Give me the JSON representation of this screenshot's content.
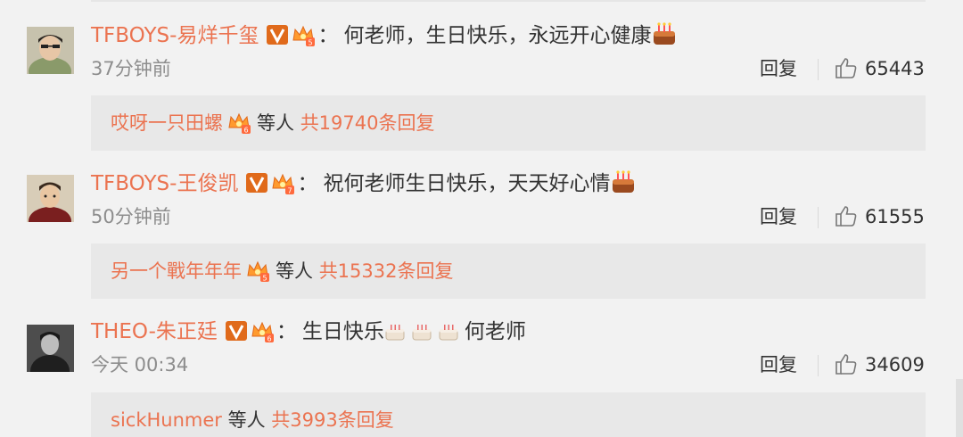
{
  "comments": [
    {
      "username": "TFBOYS-易烊千玺",
      "text": "何老师，生日快乐，永远开心健康",
      "time": "37分钟前",
      "reply_label": "回复",
      "likes": "65443",
      "reply_preview": {
        "user": "哎呀一只田螺",
        "middle": "等人",
        "count": "共19740条回复"
      }
    },
    {
      "username": "TFBOYS-王俊凯",
      "text": "祝何老师生日快乐，天天好心情",
      "time": "50分钟前",
      "reply_label": "回复",
      "likes": "61555",
      "reply_preview": {
        "user": "另一个戰年年年",
        "middle": "等人",
        "count": "共15332条回复"
      }
    },
    {
      "username": "THEO-朱正廷",
      "text": "生日快乐",
      "text_after": "何老师",
      "time": "今天 00:34",
      "reply_label": "回复",
      "likes": "34609",
      "reply_preview": {
        "user": "sickHunmer",
        "middle": "等人",
        "count": "共3993条回复"
      }
    }
  ],
  "colon": "：",
  "colors": {
    "accent": "#eb7350",
    "badge": "#eb7350",
    "background": "#f2f2f2",
    "reply_box": "#e8e8e8"
  },
  "icons": {
    "verified": "verified-v-badge-icon",
    "crown": "crown-fan-badge-icon",
    "cake": "birthday-cake-emoji-icon",
    "like": "thumbs-up-icon"
  }
}
